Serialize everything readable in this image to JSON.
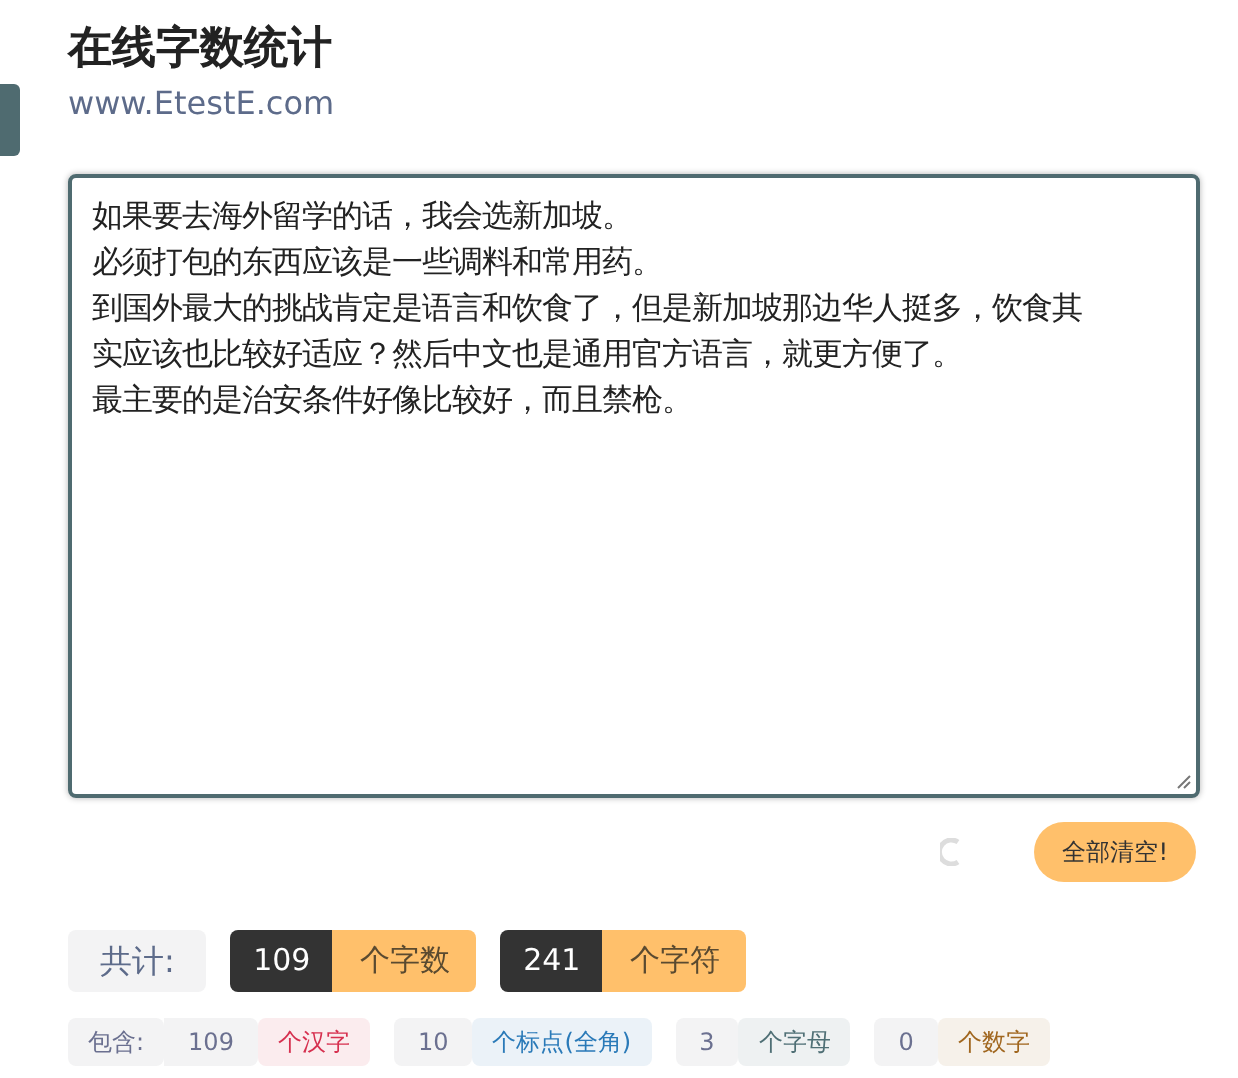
{
  "title": "在线字数统计",
  "subtitle": "www.EtestE.com",
  "editor": {
    "lines": [
      "如果要去海外留学的话，我会选新加坡。",
      "必须打包的东西应该是一些调料和常用药。",
      "到国外最大的挑战肯定是语言和饮食了，但是新加坡那边华人挺多，饮食其实应该也比较好适应？然后中文也是通用官方语言，就更方便了。",
      "最主要的是治安条件好像比较好，而且禁枪。"
    ]
  },
  "clear_button": "全部清空!",
  "totals": {
    "label": "共计:",
    "items": [
      {
        "count": "109",
        "unit": "个字数"
      },
      {
        "count": "241",
        "unit": "个字符"
      }
    ]
  },
  "breakdown": {
    "label": "包含:",
    "items": [
      {
        "count": "109",
        "unit": "个汉字",
        "color": "#d6304f"
      },
      {
        "count": "10",
        "unit": "个标点(全角)",
        "color": "#2a7ab8"
      },
      {
        "count": "3",
        "unit": "个字母",
        "color": "#4f6f75"
      },
      {
        "count": "0",
        "unit": "个数字",
        "color": "#a0661e"
      }
    ]
  }
}
